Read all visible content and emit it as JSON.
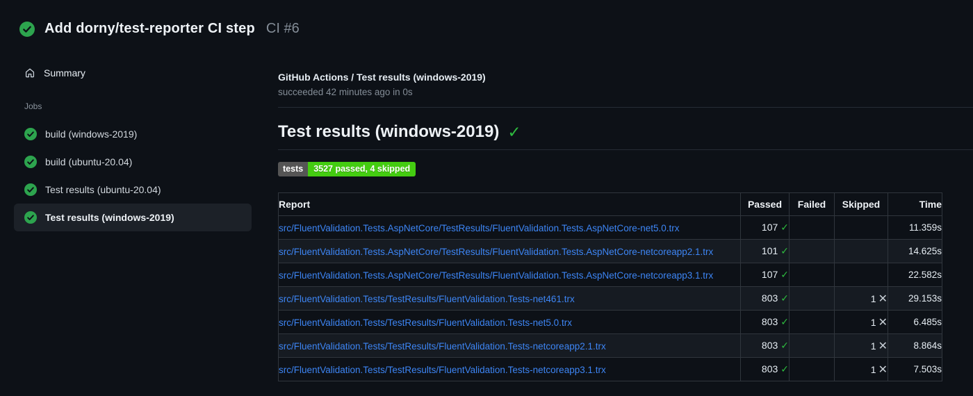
{
  "header": {
    "title": "Add dorny/test-reporter CI step",
    "run_number": "CI #6"
  },
  "sidebar": {
    "summary_label": "Summary",
    "jobs_label": "Jobs",
    "jobs": [
      {
        "label": "build (windows-2019)",
        "selected": false
      },
      {
        "label": "build (ubuntu-20.04)",
        "selected": false
      },
      {
        "label": "Test results (ubuntu-20.04)",
        "selected": false
      },
      {
        "label": "Test results (windows-2019)",
        "selected": true
      }
    ]
  },
  "main": {
    "check_title": "GitHub Actions / Test results (windows-2019)",
    "check_status": "succeeded 42 minutes ago in 0s",
    "section_title": "Test results (windows-2019)",
    "badge": {
      "label": "tests",
      "value": "3527 passed, 4 skipped"
    },
    "table": {
      "columns": {
        "report": "Report",
        "passed": "Passed",
        "failed": "Failed",
        "skipped": "Skipped",
        "time": "Time"
      },
      "rows": [
        {
          "report": "src/FluentValidation.Tests.AspNetCore/TestResults/FluentValidation.Tests.AspNetCore-net5.0.trx",
          "passed": "107",
          "failed": "",
          "skipped": "",
          "time": "11.359s"
        },
        {
          "report": "src/FluentValidation.Tests.AspNetCore/TestResults/FluentValidation.Tests.AspNetCore-netcoreapp2.1.trx",
          "passed": "101",
          "failed": "",
          "skipped": "",
          "time": "14.625s"
        },
        {
          "report": "src/FluentValidation.Tests.AspNetCore/TestResults/FluentValidation.Tests.AspNetCore-netcoreapp3.1.trx",
          "passed": "107",
          "failed": "",
          "skipped": "",
          "time": "22.582s"
        },
        {
          "report": "src/FluentValidation.Tests/TestResults/FluentValidation.Tests-net461.trx",
          "passed": "803",
          "failed": "",
          "skipped": "1",
          "time": "29.153s"
        },
        {
          "report": "src/FluentValidation.Tests/TestResults/FluentValidation.Tests-net5.0.trx",
          "passed": "803",
          "failed": "",
          "skipped": "1",
          "time": "6.485s"
        },
        {
          "report": "src/FluentValidation.Tests/TestResults/FluentValidation.Tests-netcoreapp2.1.trx",
          "passed": "803",
          "failed": "",
          "skipped": "1",
          "time": "8.864s"
        },
        {
          "report": "src/FluentValidation.Tests/TestResults/FluentValidation.Tests-netcoreapp3.1.trx",
          "passed": "803",
          "failed": "",
          "skipped": "1",
          "time": "7.503s"
        }
      ]
    }
  },
  "icons": {
    "check": "✓",
    "cross": "✕",
    "check_circle": "circle-check-icon",
    "home": "home-icon"
  },
  "colors": {
    "page_bg": "#0d1117",
    "row_stripe": "#161b22",
    "table_border": "#30363d",
    "link_blue": "#3d85f4",
    "success_green": "#2da44e",
    "check_green": "#2ebb3f",
    "badge_label_bg": "#555555",
    "badge_value_bg": "#44cc11",
    "muted_text": "#848d97",
    "selected_item_bg": "#1c2128"
  }
}
